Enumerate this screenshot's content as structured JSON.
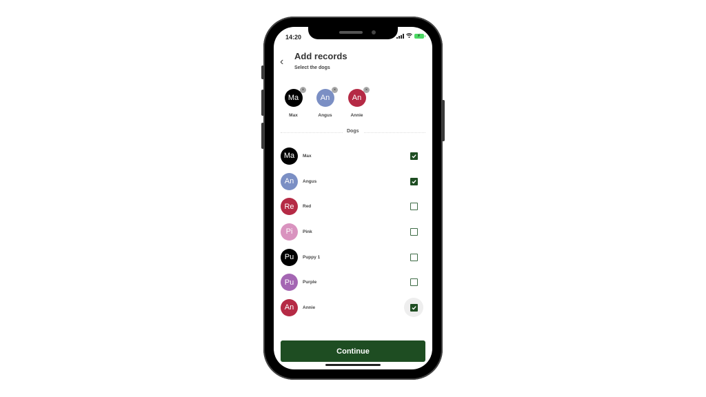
{
  "status_bar": {
    "time": "14:20",
    "signal_icon": "signal-icon",
    "wifi_icon": "wifi-icon",
    "battery_icon": "battery-charging-icon"
  },
  "header": {
    "back_icon": "chevron-left-icon",
    "back_glyph": "‹",
    "title": "Add records",
    "subtitle": "Select the dogs"
  },
  "selected": [
    {
      "initials": "Ma",
      "name": "Max",
      "color": "#000000",
      "remove_glyph": "×"
    },
    {
      "initials": "An",
      "name": "Angus",
      "color": "#7b8fc4",
      "remove_glyph": "×"
    },
    {
      "initials": "An",
      "name": "Annie",
      "color": "#b52a45",
      "remove_glyph": "×"
    }
  ],
  "section_label": "Dogs",
  "dogs": [
    {
      "initials": "Ma",
      "name": "Max",
      "color": "#000000",
      "checked": true
    },
    {
      "initials": "An",
      "name": "Angus",
      "color": "#7b8fc4",
      "checked": true
    },
    {
      "initials": "Re",
      "name": "Red",
      "color": "#b52a45",
      "checked": false
    },
    {
      "initials": "Pi",
      "name": "Pink",
      "color": "#d993bf",
      "checked": false
    },
    {
      "initials": "Pu",
      "name": "Puppy 1",
      "color": "#000000",
      "checked": false
    },
    {
      "initials": "Pu",
      "name": "Purple",
      "color": "#a466b3",
      "checked": false
    },
    {
      "initials": "An",
      "name": "Annie",
      "color": "#b52a45",
      "checked": true,
      "focused": true
    }
  ],
  "colors": {
    "accent": "#1e4d22"
  },
  "continue_label": "Continue"
}
